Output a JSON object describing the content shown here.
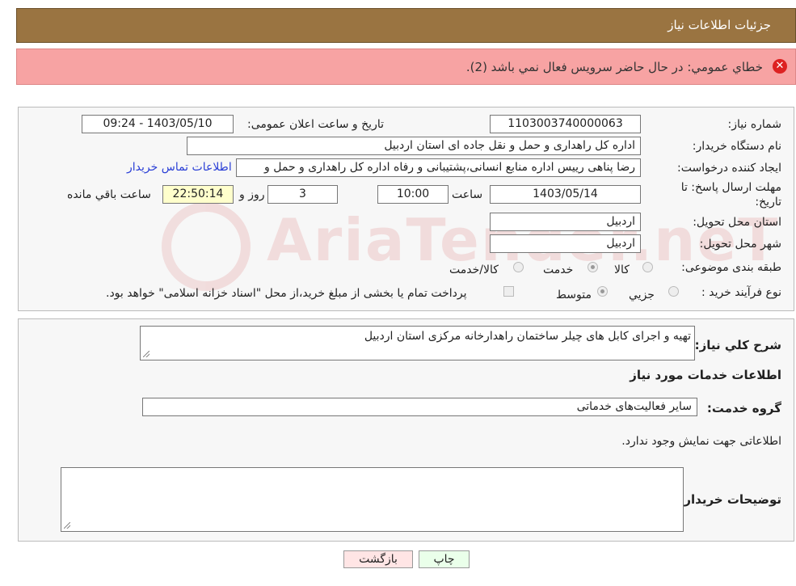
{
  "header": {
    "title": "جزئیات اطلاعات نیاز"
  },
  "error": {
    "text": "خطاي عمومي: در حال حاضر سرويس فعال نمي باشد (2)."
  },
  "form": {
    "need_number_label": "شماره نیاز:",
    "need_number": "1103003740000063",
    "announce_label": "تاریخ و ساعت اعلان عمومی:",
    "announce_value": "1403/05/10 - 09:24",
    "buyer_label": "نام دستگاه خریدار:",
    "buyer_value": "اداره کل راهداری و حمل و نقل جاده ای استان اردبیل",
    "creator_label": "ایجاد کننده درخواست:",
    "creator_value": "رضا پناهی رییس اداره منابع انسانی،پشتیبانی و رفاه اداره کل راهداری و حمل و",
    "contact_link": "اطلاعات تماس خریدار",
    "deadline_label": "مهلت ارسال پاسخ: تا تاریخ:",
    "deadline_date": "1403/05/14",
    "time_label": "ساعت",
    "deadline_time": "10:00",
    "days_value": "3",
    "days_label": "روز و",
    "remaining_time": "22:50:14",
    "remaining_label": "ساعت باقي مانده",
    "province_label": "استان محل تحویل:",
    "province_value": "اردبیل",
    "city_label": "شهر محل تحویل:",
    "city_value": "اردبیل",
    "category_label": "طبقه بندی موضوعی:",
    "category_options": [
      "کالا",
      "خدمت",
      "کالا/خدمت"
    ],
    "category_selected": "خدمت",
    "process_label": "نوع فرآیند خرید :",
    "process_options": [
      "جزیي",
      "متوسط"
    ],
    "process_selected": "متوسط",
    "payment_note": "پرداخت تمام یا بخشی از مبلغ خرید،از محل \"اسناد خزانه اسلامی\" خواهد بود."
  },
  "details": {
    "summary_label": "شرح کلي نياز:",
    "summary_value": "تهیه و اجرای کابل های چیلر ساختمان راهدارخانه مرکزی استان اردبیل",
    "services_heading": "اطلاعات خدمات مورد نياز",
    "service_group_label": "گروه خدمت:",
    "service_group_value": "سایر فعالیت‌های خدماتی",
    "no_info_text": "اطلاعاتی جهت نمایش وجود ندارد.",
    "buyer_notes_label": "توضيحات خريدار:",
    "buyer_notes_value": ""
  },
  "buttons": {
    "print": "چاپ",
    "back": "بازگشت"
  },
  "watermark": {
    "text": "AriaTender.neT"
  },
  "colors": {
    "header_bg": "#9a7441",
    "error_bg": "#f7a3a3",
    "remaining_bg": "#ffffcc",
    "print_bg": "#eaffea",
    "back_bg": "#ffe5e5",
    "link": "#2a3fd6"
  }
}
